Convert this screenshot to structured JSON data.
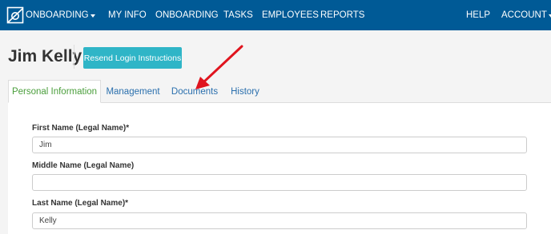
{
  "nav": {
    "brand": "ONBOARDING",
    "links": [
      "MY INFO",
      "ONBOARDING",
      "TASKS",
      "EMPLOYEES",
      "REPORTS"
    ],
    "help": "HELP",
    "account": "ACCOUNT"
  },
  "header": {
    "title": "Jim Kelly",
    "resend_label": "Resend Login Instructions"
  },
  "tabs": [
    "Personal Information",
    "Management",
    "Documents",
    "History"
  ],
  "form": {
    "first_name_label": "First Name (Legal Name)*",
    "first_name_value": "Jim",
    "middle_name_label": "Middle Name (Legal Name)",
    "middle_name_value": "",
    "last_name_label": "Last Name (Legal Name)*",
    "last_name_value": "Kelly"
  },
  "colors": {
    "navbar": "#005a96",
    "button": "#2fb5c7",
    "active_tab": "#4a9e3b",
    "link": "#2a6fad",
    "annotation_arrow": "#e0141e"
  }
}
